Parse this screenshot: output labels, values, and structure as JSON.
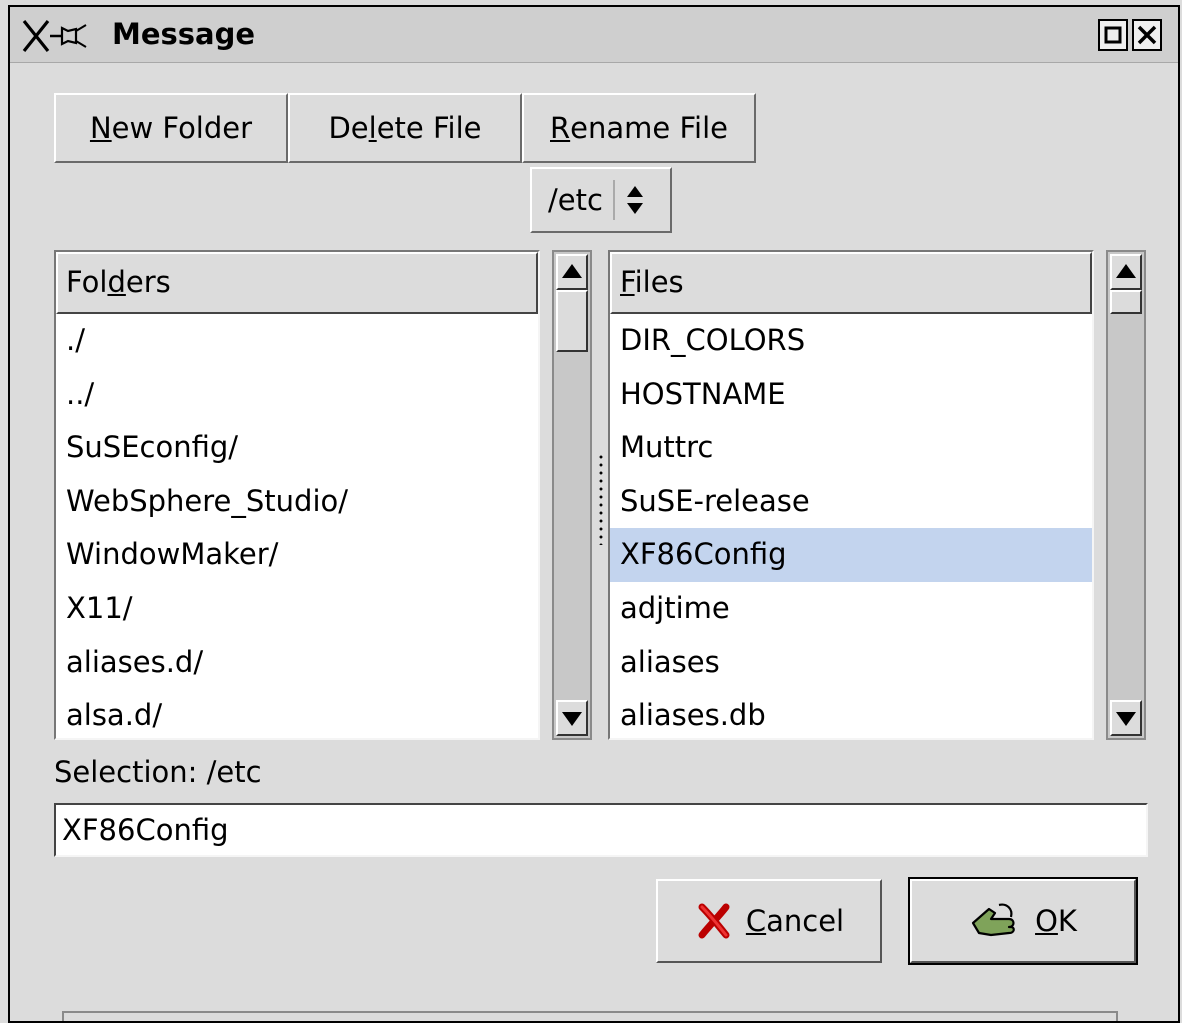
{
  "window": {
    "title": "Message"
  },
  "toolbar": {
    "new_folder": {
      "pre": "",
      "key": "N",
      "post": "ew Folder"
    },
    "delete_file": {
      "pre": "De",
      "key": "l",
      "post": "ete File"
    },
    "rename_file": {
      "pre": "",
      "key": "R",
      "post": "ename File"
    }
  },
  "path_select": {
    "value": "/etc"
  },
  "folders": {
    "header": {
      "pre": "Fol",
      "key": "d",
      "post": "ers"
    },
    "items": [
      "./",
      "../",
      "SuSEconfig/",
      "WebSphere_Studio/",
      "WindowMaker/",
      "X11/",
      "aliases.d/",
      "alsa.d/"
    ]
  },
  "files": {
    "header": {
      "pre": "",
      "key": "F",
      "post": "iles"
    },
    "items": [
      "DIR_COLORS",
      "HOSTNAME",
      "Muttrc",
      "SuSE-release",
      "XF86Config",
      "adjtime",
      "aliases",
      "aliases.db"
    ],
    "selected_index": 4
  },
  "selection": {
    "label": "Selection: /etc",
    "value": "XF86Config"
  },
  "buttons": {
    "cancel": {
      "pre": "",
      "key": "C",
      "post": "ancel"
    },
    "ok": {
      "pre": "",
      "key": "O",
      "post": "K"
    }
  },
  "colors": {
    "selected_row": "#c3d4ee",
    "dialog_bg": "#dcdcdc"
  }
}
